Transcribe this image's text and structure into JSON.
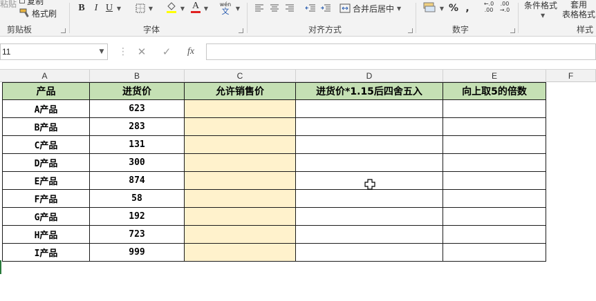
{
  "ribbon": {
    "clipboard": {
      "paste_partial": "粘贴",
      "copy_partial": "复制",
      "format_painter": "格式刷",
      "label": "剪贴板"
    },
    "font": {
      "bold": "B",
      "italic": "I",
      "underline": "U",
      "font_color_letter": "A",
      "wen_ruby": "wén",
      "wen_char": "文",
      "label": "字体"
    },
    "alignment": {
      "merge_center": "合并后居中",
      "label": "对齐方式"
    },
    "number": {
      "percent": "%",
      "comma": ",",
      "inc_decimal": "←.0 .00",
      "dec_decimal": ".00 →.0",
      "label": "数字"
    },
    "styles": {
      "conditional_format": "条件格式",
      "table_format_line1": "套用",
      "table_format_line2": "表格格式",
      "label": "样式"
    }
  },
  "formula_bar": {
    "name_box_value": "11",
    "fx": "fx",
    "formula_value": ""
  },
  "columns": [
    "A",
    "B",
    "C",
    "D",
    "E",
    "F"
  ],
  "table": {
    "headers": [
      "产品",
      "进货价",
      "允许销售价",
      "进货价*1.15后四舍五入",
      "向上取5的倍数"
    ],
    "rows": [
      {
        "product": "A产品",
        "price": "623"
      },
      {
        "product": "B产品",
        "price": "283"
      },
      {
        "product": "C产品",
        "price": "131"
      },
      {
        "product": "D产品",
        "price": "300"
      },
      {
        "product": "E产品",
        "price": "874"
      },
      {
        "product": "F产品",
        "price": "58"
      },
      {
        "product": "G产品",
        "price": "192"
      },
      {
        "product": "H产品",
        "price": "723"
      },
      {
        "product": "I产品",
        "price": "999"
      }
    ]
  },
  "colors": {
    "header_fill": "#c5e0b4",
    "highlight_fill": "#fff2cc",
    "font_color_bar": "#e02020"
  },
  "icons": [
    "paste-icon",
    "copy-icon",
    "format-painter-icon",
    "borders-icon",
    "fill-color-icon",
    "font-color-icon",
    "align-left-icon",
    "align-center-icon",
    "align-right-icon",
    "decrease-indent-icon",
    "increase-indent-icon",
    "merge-icon",
    "accounting-format-icon",
    "cancel-icon",
    "enter-icon",
    "cell-cursor-icon"
  ]
}
